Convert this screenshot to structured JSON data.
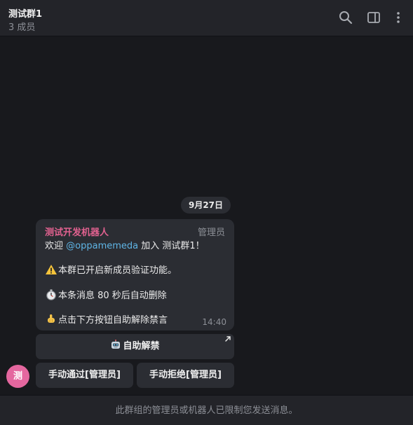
{
  "header": {
    "title": "测试群1",
    "subtitle": "3 成员",
    "icons": [
      "search-icon",
      "sidebar-toggle-icon",
      "more-vertical-icon"
    ]
  },
  "chat": {
    "date": "9月27日",
    "message": {
      "sender": "测试开发机器人",
      "role": "管理员",
      "welcome_prefix": "欢迎 ",
      "mention": "@oppamemeda",
      "welcome_suffix": " 加入 测试群1！",
      "line_verify": "本群已开启新成员验证功能。",
      "line_delete": "本条消息 80 秒后自动删除",
      "line_button": "点击下方按钮自助解除禁言",
      "time": "14:40"
    },
    "keyboard": {
      "self_unban": "自助解禁",
      "approve": "手动通过[管理员]",
      "reject": "手动拒绝[管理员]"
    },
    "avatar_letter": "测"
  },
  "footer": {
    "notice": "此群组的管理员或机器人已限制您发送消息。"
  },
  "colors": {
    "background": "#18191d",
    "header": "#232429",
    "bubble": "#2b2d33",
    "sender": "#e0618f",
    "mention": "#5fb5e6",
    "avatar": "#e4679f"
  }
}
